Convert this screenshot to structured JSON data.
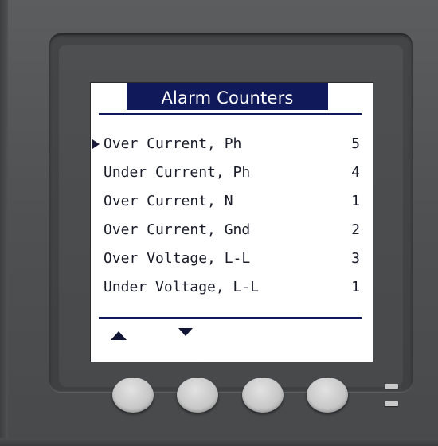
{
  "screen": {
    "title": "Alarm Counters",
    "selected_index": 0,
    "rows": [
      {
        "label": "Over Current, Ph",
        "count": "5"
      },
      {
        "label": "Under Current, Ph",
        "count": "4"
      },
      {
        "label": "Over Current, N",
        "count": "1"
      },
      {
        "label": "Over Current, Gnd",
        "count": "2"
      },
      {
        "label": "Over Voltage, L-L",
        "count": "3"
      },
      {
        "label": "Under Voltage, L-L",
        "count": "1"
      }
    ],
    "nav_icons": [
      "up-arrow-icon",
      "down-arrow-icon"
    ]
  },
  "softkeys": [
    "softkey-1",
    "softkey-2",
    "softkey-3",
    "softkey-4"
  ],
  "indicator_leds": 2,
  "colors": {
    "title_bar": "#101a5a",
    "screen_bg": "#ffffff",
    "bezel": "#4e5052",
    "softkey": "#cfcfcf"
  }
}
